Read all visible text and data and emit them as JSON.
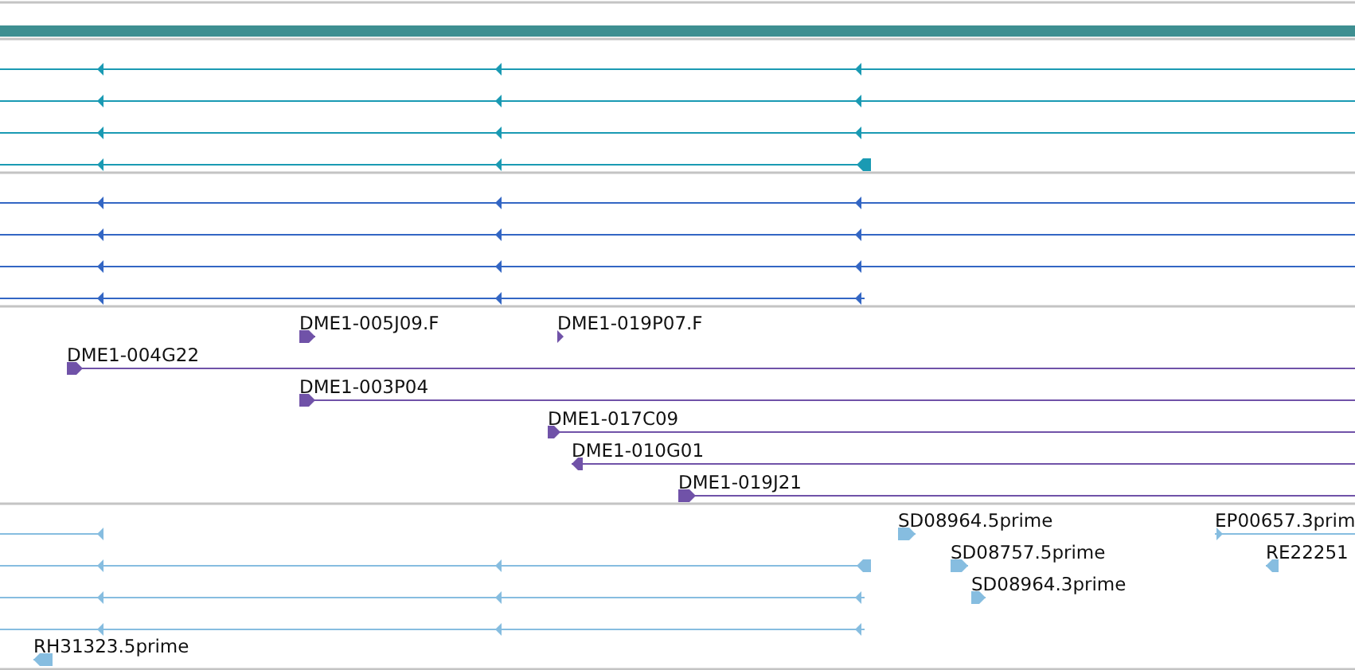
{
  "tracks": [
    {
      "color": "#1a9ab3",
      "features": [
        {
          "reverse": true
        },
        {
          "reverse": true
        },
        {
          "reverse": true
        },
        {
          "reverse": true
        }
      ]
    },
    {
      "color": "#3366c4",
      "features": [
        {
          "reverse": true
        },
        {
          "reverse": true
        },
        {
          "reverse": true
        },
        {
          "reverse": true
        }
      ]
    },
    {
      "color": "#7052a8",
      "features": [
        {
          "label": "DME1-005J09.F",
          "reverse": false
        },
        {
          "label": "DME1-019P07.F",
          "reverse": false
        },
        {
          "label": "DME1-004G22",
          "reverse": false
        },
        {
          "label": "DME1-003P04",
          "reverse": false
        },
        {
          "label": "DME1-017C09",
          "reverse": false
        },
        {
          "label": "DME1-010G01",
          "reverse": true
        },
        {
          "label": "DME1-019J21",
          "reverse": false
        }
      ]
    },
    {
      "color": "#86bde0",
      "features": [
        {
          "reverse": true
        },
        {
          "reverse": true
        },
        {
          "reverse": true
        },
        {
          "reverse": true
        },
        {
          "label": "RH31323.5prime",
          "reverse": true
        },
        {
          "label": "SD08964.5prime",
          "reverse": false
        },
        {
          "label": "SD08757.5prime",
          "reverse": false
        },
        {
          "label": "SD08964.3prime",
          "reverse": false
        },
        {
          "label": "EP00657.3prim",
          "reverse": false
        },
        {
          "label": "RE22251",
          "reverse": true
        }
      ]
    }
  ]
}
